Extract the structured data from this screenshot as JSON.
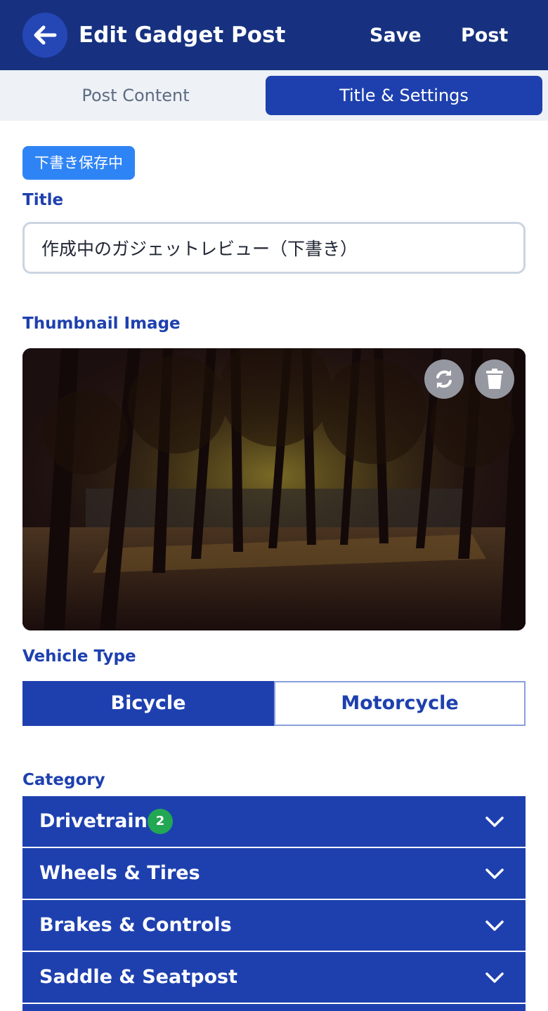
{
  "header": {
    "title": "Edit Gadget Post",
    "save_label": "Save",
    "post_label": "Post",
    "back_icon": "arrow-left-icon"
  },
  "tabs": [
    {
      "label": "Post Content",
      "active": false
    },
    {
      "label": "Title & Settings",
      "active": true
    }
  ],
  "status_badge": "下書き保存中",
  "title_field": {
    "label": "Title",
    "value": "作成中のガジェットレビュー（下書き）"
  },
  "thumbnail": {
    "label": "Thumbnail Image",
    "actions": [
      "refresh-icon",
      "trash-icon"
    ]
  },
  "vehicle_type": {
    "label": "Vehicle Type",
    "options": [
      "Bicycle",
      "Motorcycle"
    ],
    "selected": "Bicycle"
  },
  "category": {
    "label": "Category",
    "items": [
      {
        "label": "Drivetrain",
        "count": "2"
      },
      {
        "label": "Wheels & Tires"
      },
      {
        "label": "Brakes & Controls"
      },
      {
        "label": "Saddle & Seatpost"
      }
    ]
  },
  "colors": {
    "header_bg": "#173180",
    "accent": "#1e40af",
    "badge": "#2f84f5",
    "count_badge": "#22a753"
  }
}
